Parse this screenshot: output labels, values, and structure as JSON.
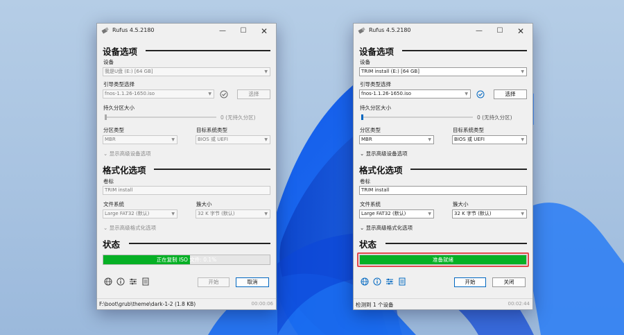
{
  "left_window": {
    "title": "Rufus 4.5.2180",
    "section_device": "设备选项",
    "device_label": "设备",
    "device_value": "我是U盘 (E:) [64 GB]",
    "boot_label": "引导类型选择",
    "boot_value": "fnos-1.1.26-1650.iso",
    "select_button": "选择",
    "persistent_label": "持久分区大小",
    "persistent_value": "0 (无持久分区)",
    "partition_label": "分区类型",
    "partition_value": "MBR",
    "target_label": "目标系统类型",
    "target_value": "BIOS 或 UEFI",
    "adv_device": "显示高级设备选项",
    "section_format": "格式化选项",
    "volume_label": "卷标",
    "volume_value": "TRIM install",
    "fs_label": "文件系统",
    "fs_value": "Large FAT32 (默认)",
    "cluster_label": "簇大小",
    "cluster_value": "32 K 字节 (默认)",
    "adv_format": "显示高级格式化选项",
    "section_status": "状态",
    "progress_text": "正在复制 ISO 文件: 0.1%",
    "progress_percent": 52,
    "start_button": "开始",
    "cancel_button": "取消",
    "status_text": "F:\\boot\\grub\\theme\\dark-1-2 (1.8 KB)",
    "status_time": "00:00:06"
  },
  "right_window": {
    "title": "Rufus 4.5.2180",
    "section_device": "设备选项",
    "device_label": "设备",
    "device_value": "TRIM install (E:) [64 GB]",
    "boot_label": "引导类型选择",
    "boot_value": "fnos-1.1.26-1650.iso",
    "select_button": "选择",
    "persistent_label": "持久分区大小",
    "persistent_value": "0 (无持久分区)",
    "partition_label": "分区类型",
    "partition_value": "MBR",
    "target_label": "目标系统类型",
    "target_value": "BIOS 或 UEFI",
    "adv_device": "显示高级设备选项",
    "section_format": "格式化选项",
    "volume_label": "卷标",
    "volume_value": "TRIM install",
    "fs_label": "文件系统",
    "fs_value": "Large FAT32 (默认)",
    "cluster_label": "簇大小",
    "cluster_value": "32 K 字节 (默认)",
    "adv_format": "显示高级格式化选项",
    "section_status": "状态",
    "progress_text": "准备就绪",
    "progress_percent": 100,
    "start_button": "开始",
    "close_button": "关闭",
    "status_text": "检测到 1 个设备",
    "status_time": "00:02:44"
  },
  "colors": {
    "progress_green": "#06b025",
    "highlight_red": "#e0474c",
    "accent_blue": "#0067c0"
  }
}
